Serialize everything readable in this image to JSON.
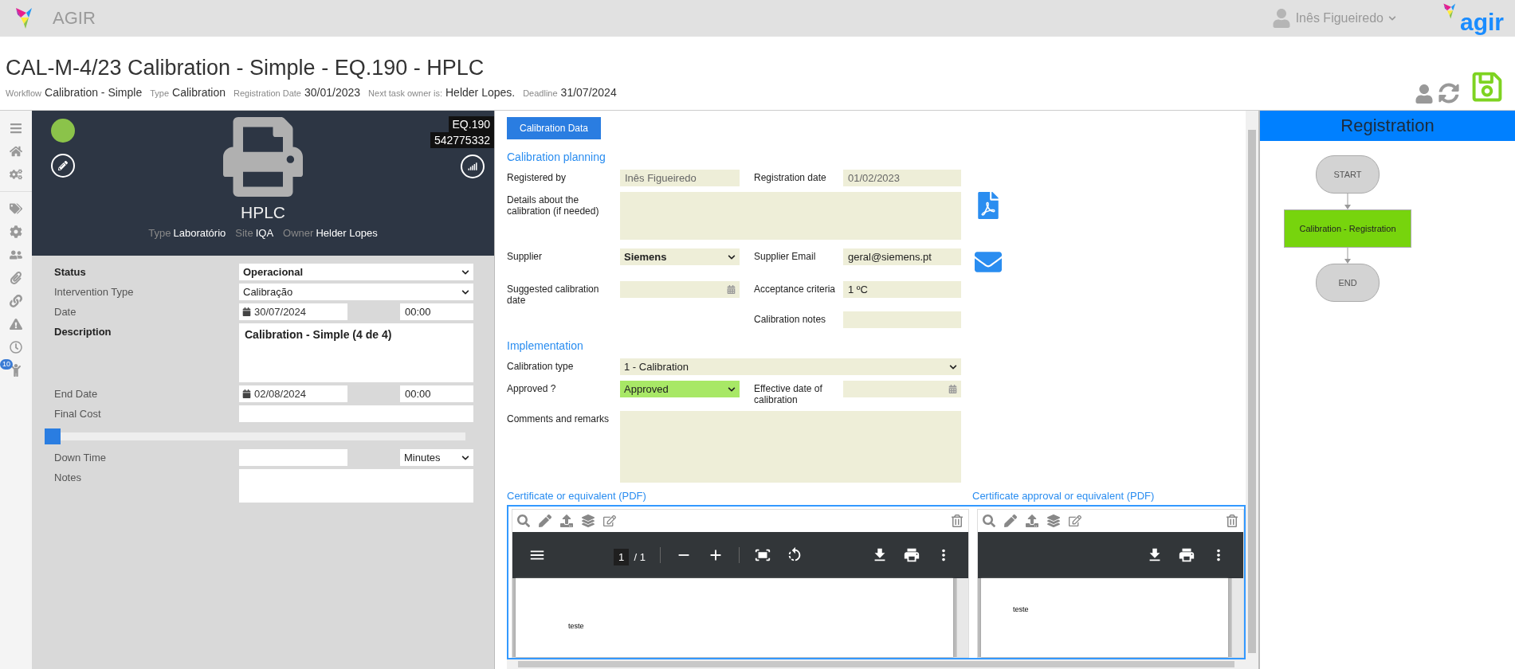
{
  "app_bar": {
    "app_name": "AGIR",
    "user_name": "Inês Figueiredo",
    "brand": "agir"
  },
  "header": {
    "title": "CAL-M-4/23 Calibration - Simple - EQ.190 - HPLC",
    "meta": [
      {
        "label": "Workflow",
        "value": "Calibration - Simple"
      },
      {
        "label": "Type",
        "value": "Calibration"
      },
      {
        "label": "Registration Date",
        "value": "30/01/2023"
      },
      {
        "label": "Next task owner is:",
        "value": "Helder Lopes."
      },
      {
        "label": "Deadline",
        "value": "31/07/2024"
      }
    ]
  },
  "sidebar": {
    "badge": "10"
  },
  "equipment": {
    "code": "EQ.190",
    "serial": "542775332",
    "name": "HPLC",
    "details": [
      {
        "label": "Type",
        "value": "Laboratório"
      },
      {
        "label": "Site",
        "value": "IQA"
      },
      {
        "label": "Owner",
        "value": "Helder Lopes"
      }
    ]
  },
  "intervention_form": [
    {
      "kind": "select",
      "label": "Status",
      "required": true,
      "value": "Operacional"
    },
    {
      "kind": "select",
      "label": "Intervention Type",
      "required": false,
      "value": "Calibração"
    },
    {
      "kind": "datetime",
      "label": "Date",
      "required": false,
      "date": "30/07/2024",
      "time": "00:00"
    },
    {
      "kind": "textarea",
      "label": "Description",
      "required": true,
      "value": "Calibration - Simple (4 de 4)"
    },
    {
      "kind": "datetime",
      "label": "End Date",
      "required": false,
      "date": "02/08/2024",
      "time": "00:00"
    },
    {
      "kind": "input",
      "label": "Final Cost",
      "required": false
    },
    {
      "kind": "slider",
      "level": 0
    },
    {
      "kind": "input_select",
      "label": "Down Time",
      "required": false,
      "unit": "Minutes"
    },
    {
      "kind": "memo",
      "label": "Notes",
      "required": false
    }
  ],
  "calibration": {
    "tab": "Calibration Data",
    "sections": [
      {
        "title": "Calibration planning",
        "rows": [
          {
            "left": {
              "kind": "text",
              "label": "Registered by",
              "value": "Inês Figueiredo",
              "readonly": true
            },
            "right": {
              "kind": "text",
              "label": "Registration date",
              "value": "01/02/2023",
              "readonly": true
            }
          },
          {
            "left": {
              "kind": "textarea",
              "label": "Details about the calibration (if needed)"
            },
            "action": {
              "kind": "pdf"
            }
          },
          {
            "left": {
              "kind": "select",
              "label": "Supplier",
              "value": "Siemens",
              "bold": true
            },
            "right": {
              "kind": "text",
              "label": "Supplier Email",
              "value": "geral@siemens.pt"
            },
            "action": {
              "kind": "mail"
            }
          },
          {
            "left": {
              "kind": "date",
              "label": "Suggested calibration date"
            },
            "right": {
              "kind": "text",
              "label": "Acceptance criteria",
              "value": "1 ºC"
            }
          },
          {
            "right": {
              "kind": "text",
              "label": "Calibration notes"
            }
          }
        ]
      },
      {
        "title": "Implementation",
        "rows": [
          {
            "left": {
              "kind": "wide_select",
              "label": "Calibration type",
              "value": "1 - Calibration"
            }
          },
          {
            "left": {
              "kind": "select",
              "label": "Approved ?",
              "value": "Approved",
              "highlighted": true
            },
            "right": {
              "kind": "date",
              "label": "Effective date of calibration"
            }
          },
          {
            "left": {
              "kind": "textarea",
              "label": "Comments and remarks"
            }
          }
        ]
      }
    ]
  },
  "certificates": [
    {
      "title": "Certificate or equivalent (PDF)",
      "viewer": {
        "kind": "full",
        "page": "1",
        "pages": "/ 1",
        "content": "teste"
      }
    },
    {
      "title": "Certificate approval or equivalent (PDF)",
      "viewer": {
        "kind": "compact",
        "content": "teste"
      }
    }
  ],
  "workflow": {
    "title": "Registration",
    "nodes": [
      {
        "kind": "terminal",
        "label": "START",
        "current": false
      },
      {
        "kind": "task",
        "label": "Calibration - Registration",
        "current": true
      },
      {
        "kind": "terminal",
        "label": "END",
        "current": false
      }
    ]
  }
}
